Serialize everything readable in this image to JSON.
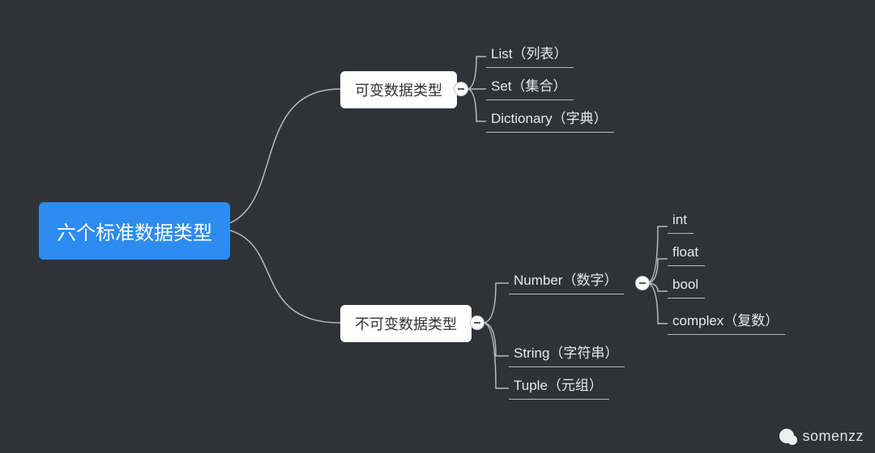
{
  "root": {
    "label": "六个标准数据类型"
  },
  "branches": {
    "mutable": {
      "label": "可变数据类型",
      "children": [
        {
          "label": "List（列表）"
        },
        {
          "label": "Set（集合）"
        },
        {
          "label": "Dictionary（字典）"
        }
      ]
    },
    "immutable": {
      "label": "不可变数据类型",
      "children": [
        {
          "label": "Number（数字）",
          "children": [
            {
              "label": "int"
            },
            {
              "label": "float"
            },
            {
              "label": "bool"
            },
            {
              "label": "complex（复数）"
            }
          ]
        },
        {
          "label": "String（字符串）"
        },
        {
          "label": "Tuple（元组）"
        }
      ]
    }
  },
  "colors": {
    "bg": "#2f3338",
    "accent": "#2d8cf0",
    "node_bg": "#ffffff",
    "line": "#b9bbbe"
  },
  "watermark": "somenzz"
}
